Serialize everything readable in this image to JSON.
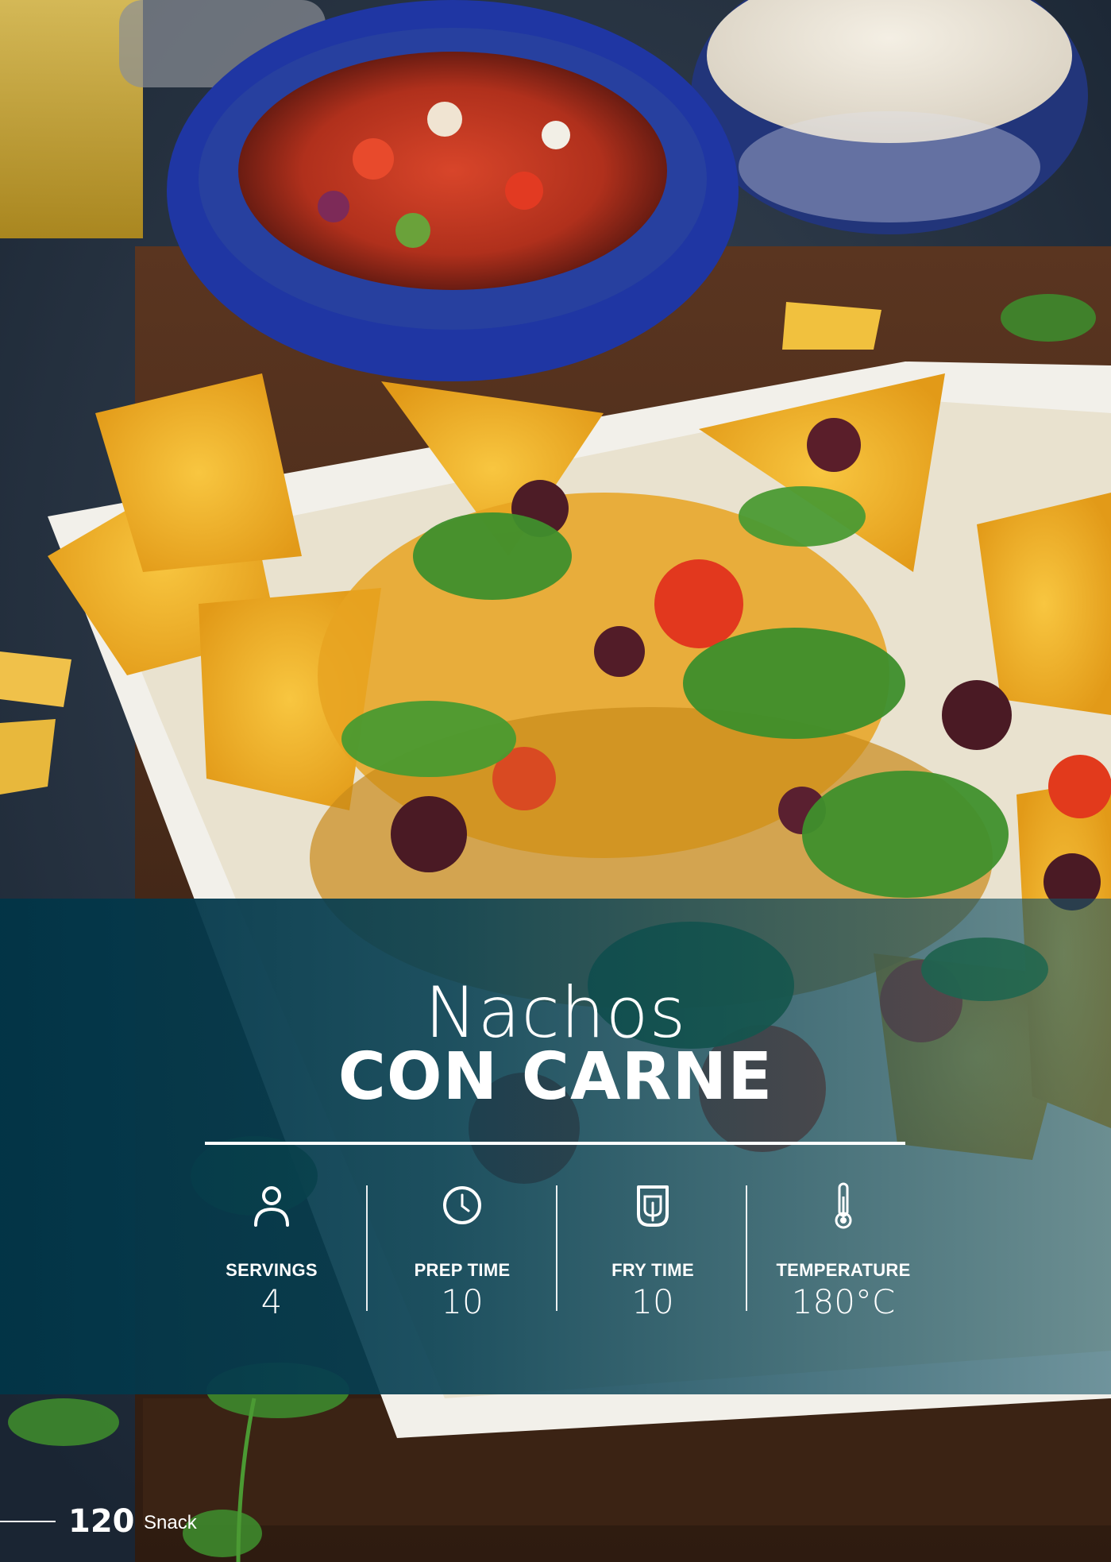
{
  "recipe": {
    "title_line1": "Nachos",
    "title_line2": "CON CARNE"
  },
  "stats": [
    {
      "icon": "person-icon",
      "label": "SERVINGS",
      "value": "4"
    },
    {
      "icon": "clock-icon",
      "label": "PREP TIME",
      "value": "10"
    },
    {
      "icon": "air-fryer-icon",
      "label": "FRY TIME",
      "value": "10"
    },
    {
      "icon": "thermometer-icon",
      "label": "TEMPERATURE",
      "value": "180°C"
    }
  ],
  "footer": {
    "page_number": "120",
    "section": "Snack"
  },
  "colors": {
    "overlay": "#023446",
    "text": "#ffffff",
    "board": "#3a2417",
    "salsa_bowl": "#1d3aa0"
  }
}
